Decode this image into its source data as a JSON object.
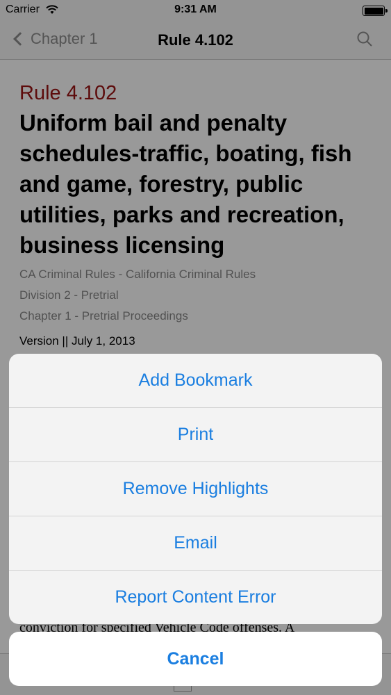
{
  "status_bar": {
    "carrier": "Carrier",
    "time": "9:31 AM"
  },
  "nav": {
    "back_label": "Chapter 1",
    "title": "Rule 4.102"
  },
  "rule": {
    "number": "Rule 4.102",
    "title": "Uniform bail and penalty schedules-traffic, boating, fish and game, forestry, public utilities, parks and recreation, business licensing",
    "breadcrumbs": [
      "CA Criminal Rules - California Criminal Rules",
      "Division 2 - Pretrial",
      "Chapter 1 - Pretrial Proceedings"
    ],
    "version": "Version || July 1, 2013",
    "body_excerpt": "conviction for specified Vehicle Code offenses. A"
  },
  "action_sheet": {
    "items": [
      "Add Bookmark",
      "Print",
      "Remove Highlights",
      "Email",
      "Report Content Error"
    ],
    "cancel_label": "Cancel"
  },
  "colors": {
    "accent": "#1a7ee0",
    "rule_number": "#9b1414"
  }
}
